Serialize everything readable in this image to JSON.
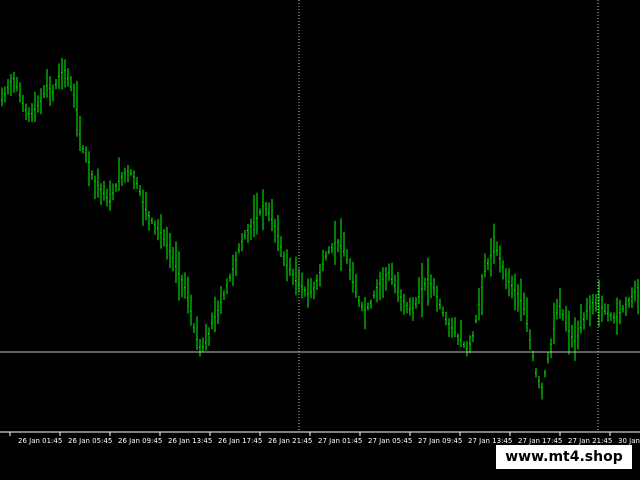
{
  "chart_data": {
    "type": "candlestick",
    "x_labels": [
      "26 Jan 01:45",
      "26 Jan 05:45",
      "26 Jan 09:45",
      "26 Jan 13:45",
      "26 Jan 17:45",
      "26 Jan 21:45",
      "27 Jan 01:45",
      "27 Jan 05:45",
      "27 Jan 09:45",
      "27 Jan 13:45",
      "27 Jan 17:45",
      "27 Jan 21:45",
      "30 Jan"
    ],
    "grid": "off",
    "vertical_period_separators": true,
    "horizontal_level_line": true,
    "colors": {
      "background": "#000000",
      "bars": "#00ff00",
      "axis": "#ffffff",
      "separator": "#c8c8c8",
      "level_line": "#c0c0c0"
    },
    "close_profile": [
      0.18,
      0.15,
      0.12,
      0.16,
      0.2,
      0.22,
      0.2,
      0.18,
      0.14,
      0.16,
      0.12,
      0.1,
      0.14,
      0.18,
      0.3,
      0.32,
      0.38,
      0.4,
      0.42,
      0.44,
      0.4,
      0.38,
      0.36,
      0.37,
      0.4,
      0.45,
      0.48,
      0.5,
      0.52,
      0.55,
      0.58,
      0.62,
      0.65,
      0.7,
      0.78,
      0.82,
      0.8,
      0.75,
      0.72,
      0.68,
      0.64,
      0.6,
      0.55,
      0.52,
      0.5,
      0.48,
      0.45,
      0.47,
      0.5,
      0.55,
      0.6,
      0.62,
      0.65,
      0.66,
      0.68,
      0.66,
      0.62,
      0.58,
      0.56,
      0.54,
      0.56,
      0.6,
      0.66,
      0.7,
      0.72,
      0.7,
      0.66,
      0.64,
      0.62,
      0.65,
      0.68,
      0.7,
      0.72,
      0.7,
      0.66,
      0.64,
      0.66,
      0.7,
      0.74,
      0.76,
      0.78,
      0.8,
      0.82,
      0.78,
      0.7,
      0.62,
      0.58,
      0.56,
      0.6,
      0.64,
      0.66,
      0.68,
      0.72,
      0.8,
      0.88,
      0.92,
      0.85,
      0.78,
      0.7,
      0.74,
      0.78,
      0.8,
      0.76,
      0.72,
      0.7,
      0.7,
      0.72,
      0.73,
      0.74,
      0.72,
      0.7,
      0.68,
      0.66,
      0.65
    ]
  },
  "watermark": {
    "text": "www.mt4.shop"
  }
}
